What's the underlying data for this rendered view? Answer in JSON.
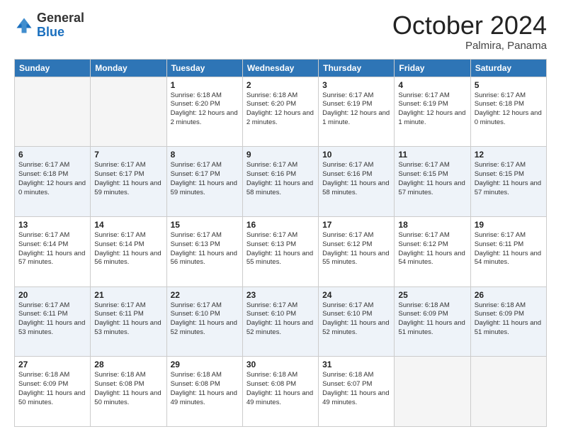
{
  "header": {
    "logo": {
      "general": "General",
      "blue": "Blue"
    },
    "title": "October 2024",
    "location": "Palmira, Panama"
  },
  "days_of_week": [
    "Sunday",
    "Monday",
    "Tuesday",
    "Wednesday",
    "Thursday",
    "Friday",
    "Saturday"
  ],
  "rows": [
    {
      "cells": [
        {
          "day": "",
          "empty": true
        },
        {
          "day": "",
          "empty": true
        },
        {
          "day": "1",
          "sunrise": "Sunrise: 6:18 AM",
          "sunset": "Sunset: 6:20 PM",
          "daylight": "Daylight: 12 hours and 2 minutes."
        },
        {
          "day": "2",
          "sunrise": "Sunrise: 6:18 AM",
          "sunset": "Sunset: 6:20 PM",
          "daylight": "Daylight: 12 hours and 2 minutes."
        },
        {
          "day": "3",
          "sunrise": "Sunrise: 6:17 AM",
          "sunset": "Sunset: 6:19 PM",
          "daylight": "Daylight: 12 hours and 1 minute."
        },
        {
          "day": "4",
          "sunrise": "Sunrise: 6:17 AM",
          "sunset": "Sunset: 6:19 PM",
          "daylight": "Daylight: 12 hours and 1 minute."
        },
        {
          "day": "5",
          "sunrise": "Sunrise: 6:17 AM",
          "sunset": "Sunset: 6:18 PM",
          "daylight": "Daylight: 12 hours and 0 minutes."
        }
      ]
    },
    {
      "stripe": true,
      "cells": [
        {
          "day": "6",
          "sunrise": "Sunrise: 6:17 AM",
          "sunset": "Sunset: 6:18 PM",
          "daylight": "Daylight: 12 hours and 0 minutes."
        },
        {
          "day": "7",
          "sunrise": "Sunrise: 6:17 AM",
          "sunset": "Sunset: 6:17 PM",
          "daylight": "Daylight: 11 hours and 59 minutes."
        },
        {
          "day": "8",
          "sunrise": "Sunrise: 6:17 AM",
          "sunset": "Sunset: 6:17 PM",
          "daylight": "Daylight: 11 hours and 59 minutes."
        },
        {
          "day": "9",
          "sunrise": "Sunrise: 6:17 AM",
          "sunset": "Sunset: 6:16 PM",
          "daylight": "Daylight: 11 hours and 58 minutes."
        },
        {
          "day": "10",
          "sunrise": "Sunrise: 6:17 AM",
          "sunset": "Sunset: 6:16 PM",
          "daylight": "Daylight: 11 hours and 58 minutes."
        },
        {
          "day": "11",
          "sunrise": "Sunrise: 6:17 AM",
          "sunset": "Sunset: 6:15 PM",
          "daylight": "Daylight: 11 hours and 57 minutes."
        },
        {
          "day": "12",
          "sunrise": "Sunrise: 6:17 AM",
          "sunset": "Sunset: 6:15 PM",
          "daylight": "Daylight: 11 hours and 57 minutes."
        }
      ]
    },
    {
      "cells": [
        {
          "day": "13",
          "sunrise": "Sunrise: 6:17 AM",
          "sunset": "Sunset: 6:14 PM",
          "daylight": "Daylight: 11 hours and 57 minutes."
        },
        {
          "day": "14",
          "sunrise": "Sunrise: 6:17 AM",
          "sunset": "Sunset: 6:14 PM",
          "daylight": "Daylight: 11 hours and 56 minutes."
        },
        {
          "day": "15",
          "sunrise": "Sunrise: 6:17 AM",
          "sunset": "Sunset: 6:13 PM",
          "daylight": "Daylight: 11 hours and 56 minutes."
        },
        {
          "day": "16",
          "sunrise": "Sunrise: 6:17 AM",
          "sunset": "Sunset: 6:13 PM",
          "daylight": "Daylight: 11 hours and 55 minutes."
        },
        {
          "day": "17",
          "sunrise": "Sunrise: 6:17 AM",
          "sunset": "Sunset: 6:12 PM",
          "daylight": "Daylight: 11 hours and 55 minutes."
        },
        {
          "day": "18",
          "sunrise": "Sunrise: 6:17 AM",
          "sunset": "Sunset: 6:12 PM",
          "daylight": "Daylight: 11 hours and 54 minutes."
        },
        {
          "day": "19",
          "sunrise": "Sunrise: 6:17 AM",
          "sunset": "Sunset: 6:11 PM",
          "daylight": "Daylight: 11 hours and 54 minutes."
        }
      ]
    },
    {
      "stripe": true,
      "cells": [
        {
          "day": "20",
          "sunrise": "Sunrise: 6:17 AM",
          "sunset": "Sunset: 6:11 PM",
          "daylight": "Daylight: 11 hours and 53 minutes."
        },
        {
          "day": "21",
          "sunrise": "Sunrise: 6:17 AM",
          "sunset": "Sunset: 6:11 PM",
          "daylight": "Daylight: 11 hours and 53 minutes."
        },
        {
          "day": "22",
          "sunrise": "Sunrise: 6:17 AM",
          "sunset": "Sunset: 6:10 PM",
          "daylight": "Daylight: 11 hours and 52 minutes."
        },
        {
          "day": "23",
          "sunrise": "Sunrise: 6:17 AM",
          "sunset": "Sunset: 6:10 PM",
          "daylight": "Daylight: 11 hours and 52 minutes."
        },
        {
          "day": "24",
          "sunrise": "Sunrise: 6:17 AM",
          "sunset": "Sunset: 6:10 PM",
          "daylight": "Daylight: 11 hours and 52 minutes."
        },
        {
          "day": "25",
          "sunrise": "Sunrise: 6:18 AM",
          "sunset": "Sunset: 6:09 PM",
          "daylight": "Daylight: 11 hours and 51 minutes."
        },
        {
          "day": "26",
          "sunrise": "Sunrise: 6:18 AM",
          "sunset": "Sunset: 6:09 PM",
          "daylight": "Daylight: 11 hours and 51 minutes."
        }
      ]
    },
    {
      "cells": [
        {
          "day": "27",
          "sunrise": "Sunrise: 6:18 AM",
          "sunset": "Sunset: 6:09 PM",
          "daylight": "Daylight: 11 hours and 50 minutes."
        },
        {
          "day": "28",
          "sunrise": "Sunrise: 6:18 AM",
          "sunset": "Sunset: 6:08 PM",
          "daylight": "Daylight: 11 hours and 50 minutes."
        },
        {
          "day": "29",
          "sunrise": "Sunrise: 6:18 AM",
          "sunset": "Sunset: 6:08 PM",
          "daylight": "Daylight: 11 hours and 49 minutes."
        },
        {
          "day": "30",
          "sunrise": "Sunrise: 6:18 AM",
          "sunset": "Sunset: 6:08 PM",
          "daylight": "Daylight: 11 hours and 49 minutes."
        },
        {
          "day": "31",
          "sunrise": "Sunrise: 6:18 AM",
          "sunset": "Sunset: 6:07 PM",
          "daylight": "Daylight: 11 hours and 49 minutes."
        },
        {
          "day": "",
          "empty": true
        },
        {
          "day": "",
          "empty": true
        }
      ]
    }
  ]
}
